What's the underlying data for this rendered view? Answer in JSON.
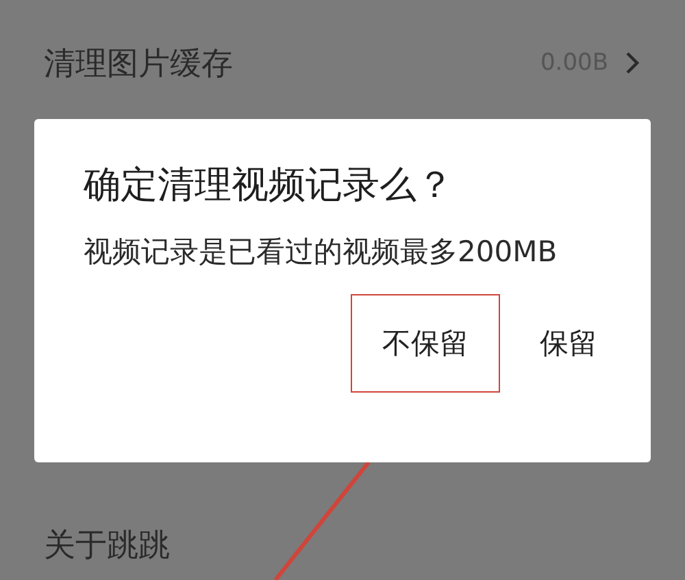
{
  "settings": [
    {
      "label": "清理图片缓存",
      "value": "0.00B"
    },
    {
      "label": "关于跳跳"
    }
  ],
  "dialog": {
    "title": "确定清理视频记录么？",
    "message": "视频记录是已看过的视频最多200MB",
    "buttons": [
      {
        "label": "不保留",
        "highlighted": true
      },
      {
        "label": "保留",
        "highlighted": false
      }
    ]
  }
}
